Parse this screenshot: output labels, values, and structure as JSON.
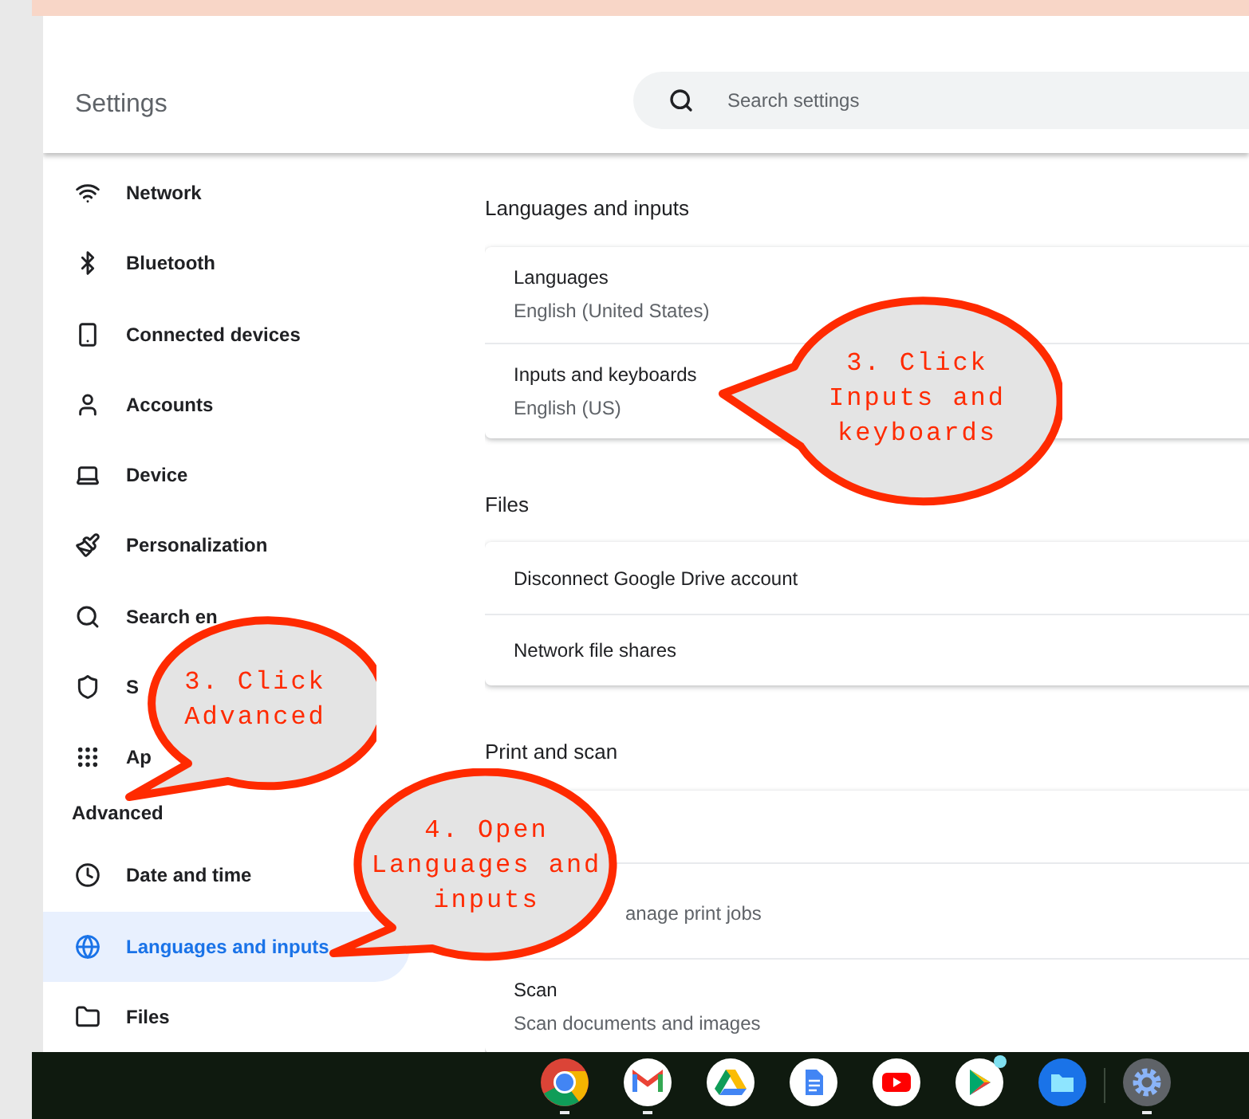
{
  "window": {
    "title": "Settings"
  },
  "search": {
    "placeholder": "Search settings"
  },
  "sidebar": {
    "items": [
      {
        "label": "Network",
        "selected": false
      },
      {
        "label": "Bluetooth",
        "selected": false
      },
      {
        "label": "Connected devices",
        "selected": false
      },
      {
        "label": "Accounts",
        "selected": false
      },
      {
        "label": "Device",
        "selected": false
      },
      {
        "label": "Personalization",
        "selected": false
      },
      {
        "label": "Search en",
        "selected": false
      },
      {
        "label": "S",
        "selected": false
      },
      {
        "label": "Ap",
        "selected": false
      }
    ],
    "advanced_heading": "Advanced",
    "advanced_items": [
      {
        "label": "Date and time",
        "selected": false
      },
      {
        "label": "Languages and inputs",
        "selected": true
      },
      {
        "label": "Files",
        "selected": false
      }
    ]
  },
  "sections": [
    {
      "title": "Languages and inputs",
      "rows": [
        {
          "title": "Languages",
          "subtitle": "English (United States)"
        },
        {
          "title": "Inputs and keyboards",
          "subtitle": "English (US)"
        }
      ]
    },
    {
      "title": "Files",
      "rows": [
        {
          "title": "Disconnect Google Drive account"
        },
        {
          "title": "Network file shares"
        }
      ]
    },
    {
      "title": "Print and scan",
      "rows": [
        {},
        {
          "subtitle": "anage print jobs"
        },
        {
          "title": "Scan",
          "subtitle": "Scan documents and images"
        }
      ]
    }
  ],
  "callouts": [
    {
      "lines": [
        "3. Click",
        "Inputs and",
        "keyboards"
      ]
    },
    {
      "lines": [
        "3. Click",
        "Advanced"
      ]
    },
    {
      "lines": [
        "4. Open",
        "Languages and",
        "inputs"
      ]
    }
  ],
  "shelf": {
    "apps": [
      {
        "running": true,
        "badge": false
      },
      {
        "running": true,
        "badge": false
      },
      {
        "running": false,
        "badge": false
      },
      {
        "running": false,
        "badge": false
      },
      {
        "running": false,
        "badge": false
      },
      {
        "running": false,
        "badge": true
      },
      {
        "running": false,
        "badge": false
      },
      {
        "running": true,
        "badge": false
      }
    ]
  }
}
